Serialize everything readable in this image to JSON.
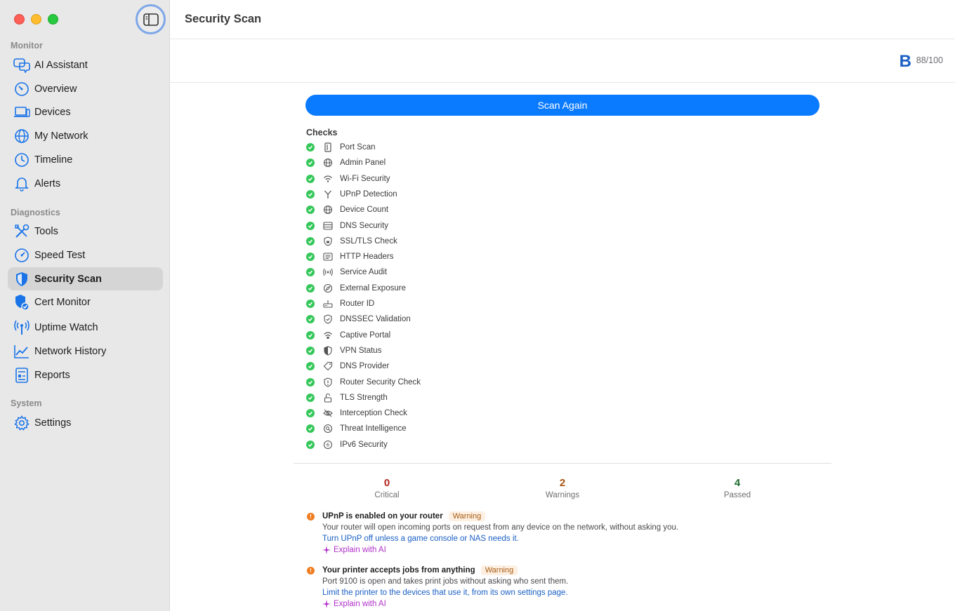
{
  "window": {
    "title": "Security Scan"
  },
  "sidebar": {
    "sections": [
      "Monitor",
      "Diagnostics",
      "System"
    ],
    "items": [
      {
        "label": "AI Assistant",
        "icon": "chat-bubbles-icon"
      },
      {
        "label": "Overview",
        "icon": "gauge-icon"
      },
      {
        "label": "Devices",
        "icon": "laptop-icon"
      },
      {
        "label": "My Network",
        "icon": "globe-icon"
      },
      {
        "label": "Timeline",
        "icon": "clock-icon"
      },
      {
        "label": "Alerts",
        "icon": "bell-icon"
      },
      {
        "label": "Tools",
        "icon": "tools-icon"
      },
      {
        "label": "Speed Test",
        "icon": "speedometer-icon"
      },
      {
        "label": "Security Scan",
        "icon": "shield-icon",
        "active": true
      },
      {
        "label": "Cert Monitor",
        "icon": "shield-check-icon"
      },
      {
        "label": "Uptime Watch",
        "icon": "antenna-icon"
      },
      {
        "label": "Network History",
        "icon": "line-chart-icon"
      },
      {
        "label": "Reports",
        "icon": "report-icon"
      },
      {
        "label": "Settings",
        "icon": "gear-icon"
      }
    ]
  },
  "header": {
    "grade": "B",
    "score": "88/100"
  },
  "scan_button": "Scan Again",
  "checks": {
    "title": "Checks",
    "items": [
      {
        "label": "Port Scan",
        "icon": "port-icon"
      },
      {
        "label": "Admin Panel",
        "icon": "globe-icon"
      },
      {
        "label": "Wi-Fi Security",
        "icon": "wifi-icon"
      },
      {
        "label": "UPnP Detection",
        "icon": "fork-icon"
      },
      {
        "label": "Device Count",
        "icon": "globe-icon"
      },
      {
        "label": "DNS Security",
        "icon": "server-icon"
      },
      {
        "label": "SSL/TLS Check",
        "icon": "shield-lock-icon"
      },
      {
        "label": "HTTP Headers",
        "icon": "list-icon"
      },
      {
        "label": "Service Audit",
        "icon": "broadcast-icon"
      },
      {
        "label": "External Exposure",
        "icon": "compass-icon"
      },
      {
        "label": "Router ID",
        "icon": "router-icon"
      },
      {
        "label": "DNSSEC Validation",
        "icon": "shield-check-icon"
      },
      {
        "label": "Captive Portal",
        "icon": "wifi-lock-icon"
      },
      {
        "label": "VPN Status",
        "icon": "half-shield-icon"
      },
      {
        "label": "DNS Provider",
        "icon": "tag-icon"
      },
      {
        "label": "Router Security Check",
        "icon": "shield-exclaim-icon"
      },
      {
        "label": "TLS Strength",
        "icon": "lock-open-icon"
      },
      {
        "label": "Interception Check",
        "icon": "eye-slash-icon"
      },
      {
        "label": "Threat Intelligence",
        "icon": "magnifier-icon"
      },
      {
        "label": "IPv6 Security",
        "icon": "six-circle-icon"
      }
    ]
  },
  "summary": {
    "critical": {
      "value": "0",
      "label": "Critical",
      "color": "#b3261e"
    },
    "warnings": {
      "value": "2",
      "label": "Warnings",
      "color": "#a6520f"
    },
    "passed": {
      "value": "4",
      "label": "Passed",
      "color": "#1e6b2e"
    }
  },
  "findings": [
    {
      "title": "UPnP is enabled on your router",
      "badge": "Warning",
      "description": "Your router will open incoming ports on request from any device on the network, without asking you.",
      "fix": "Turn UPnP off unless a game console or NAS needs it.",
      "ai": "Explain with AI"
    },
    {
      "title": "Your printer accepts jobs from anything",
      "badge": "Warning",
      "description": "Port 9100 is open and takes print jobs without asking who sent them.",
      "fix": "Limit the printer to the devices that use it, from its own settings page.",
      "ai": "Explain with AI"
    }
  ]
}
